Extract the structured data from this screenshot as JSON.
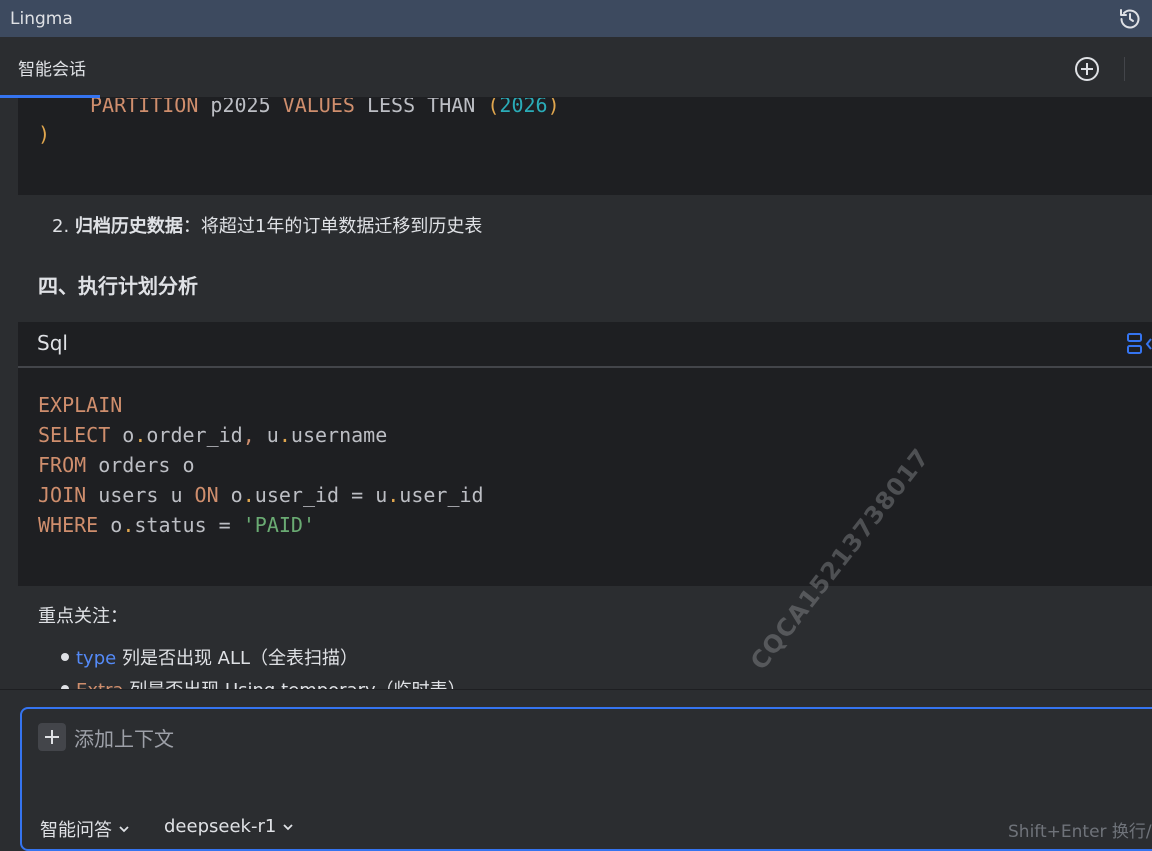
{
  "window": {
    "title": "Lingma"
  },
  "tabs": {
    "active_label": "智能会话"
  },
  "code_block_1": {
    "line1": {
      "kw1": "PARTITION",
      "id1": " p2025 ",
      "kw2": "VALUES",
      "id2": " LESS THAN ",
      "p1": "(",
      "num": "2026",
      "p2": ")"
    },
    "line2": ")"
  },
  "list_item_2": {
    "number": "2.",
    "bold": "归档历史数据",
    "rest": "：将超过1年的订单数据迁移到历史表"
  },
  "section_heading": "四、执行计划分析",
  "code_block_2": {
    "language": "Sql",
    "lines": [
      {
        "kw": "EXPLAIN"
      },
      {
        "kw": "SELECT",
        "rest1": " o",
        "dot1": ".",
        "rest2": "order_id",
        "comma": ",",
        "rest3": " u",
        "dot2": ".",
        "rest4": "username"
      },
      {
        "kw": "FROM",
        "rest": " orders o"
      },
      {
        "kw": "JOIN",
        "rest1": " users u ",
        "kw2": "ON",
        "rest2": " o",
        "dot1": ".",
        "rest3": "user_id = u",
        "dot2": ".",
        "rest4": "user_id"
      },
      {
        "kw": "WHERE",
        "rest1": " o",
        "dot": ".",
        "rest2": "status = ",
        "str": "'PAID'"
      }
    ]
  },
  "focus_section": {
    "label": "重点关注：",
    "items": [
      {
        "code": "type",
        "text": " 列是否出现 ALL（全表扫描）"
      },
      {
        "code": "Extra",
        "text": " 列是否出现 Using temporary（临时表）"
      }
    ]
  },
  "watermark": "CQCA15213738017",
  "input": {
    "placeholder": "添加上下文",
    "mode": "智能问答",
    "model": "deepseek-r1",
    "hint": "Shift+Enter 换行/"
  }
}
